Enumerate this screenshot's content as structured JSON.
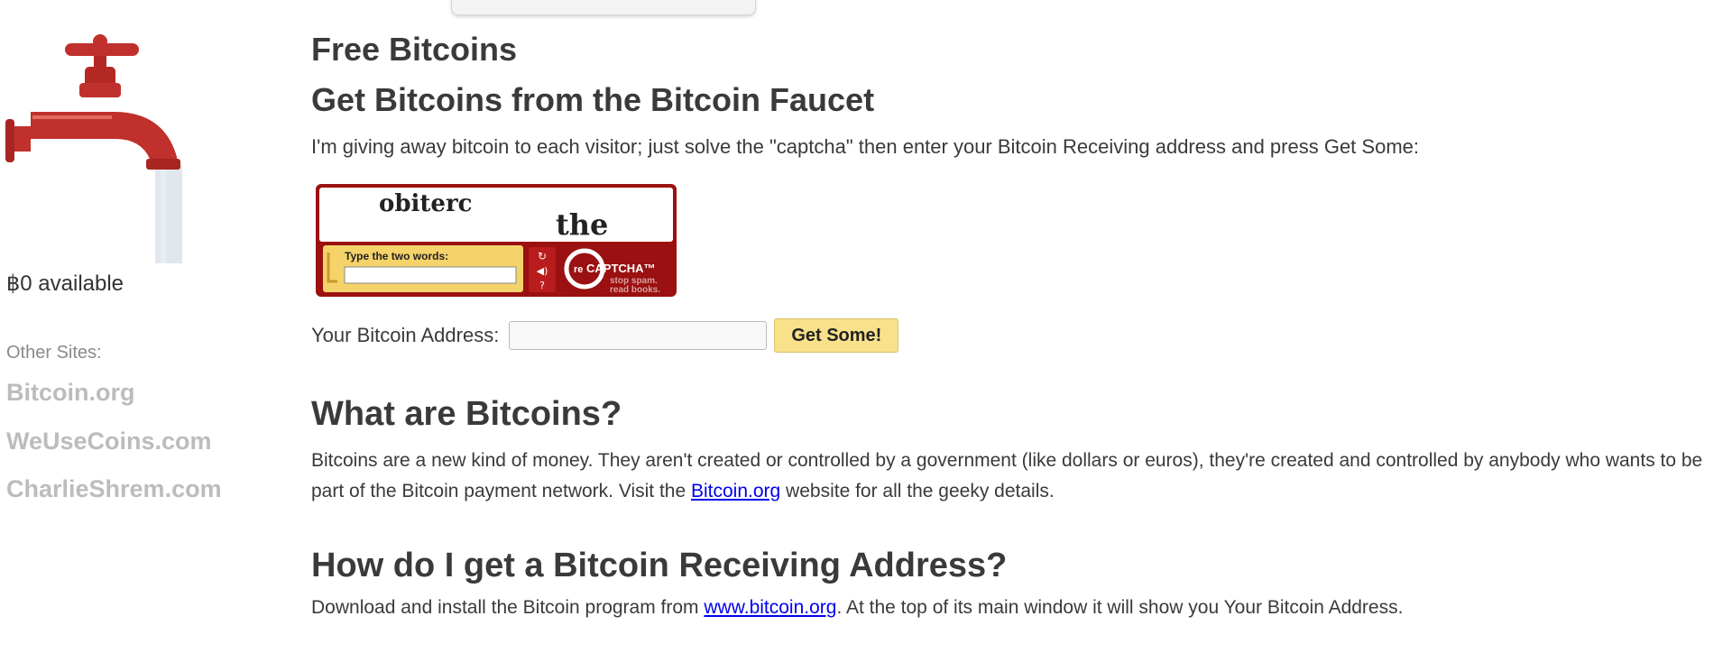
{
  "sidebar": {
    "available": "฿0 available",
    "other_sites_label": "Other Sites:",
    "sites": [
      "Bitcoin.org",
      "WeUseCoins.com",
      "CharlieShrem.com"
    ]
  },
  "main": {
    "title": "Free Bitcoins",
    "subtitle": "Get Bitcoins from the Bitcoin Faucet",
    "intro": "I'm giving away bitcoin to each visitor; just solve the \"captcha\" then enter your Bitcoin Receiving address and press Get Some:",
    "captcha": {
      "word1": "obiterc",
      "word2": "the",
      "prompt": "Type the two words:",
      "brand_prefix": "re",
      "brand": "CAPTCHA™",
      "tagline1": "stop spam.",
      "tagline2": "read books."
    },
    "address_label": "Your Bitcoin Address:",
    "address_value": "",
    "address_placeholder": "",
    "submit_label": "Get Some!",
    "what": {
      "heading": "What are Bitcoins?",
      "text_before": "Bitcoins are a new kind of money. They aren't created or controlled by a government (like dollars or euros), they're created and controlled by anybody who wants to be part of the Bitcoin payment network. Visit the ",
      "link": "Bitcoin.org",
      "text_after": " website for all the geeky details."
    },
    "how": {
      "heading": "How do I get a Bitcoin Receiving Address?",
      "text_before": "Download and install the Bitcoin program from ",
      "link": "www.bitcoin.org",
      "text_after": ". At the top of its main window it will show you Your Bitcoin Address."
    }
  },
  "colors": {
    "button": "#f8e18a",
    "faucet_red": "#c0302c",
    "captcha_red": "#9b1010",
    "link": "#0000ee",
    "sidebar_link": "#bcbcbc"
  }
}
